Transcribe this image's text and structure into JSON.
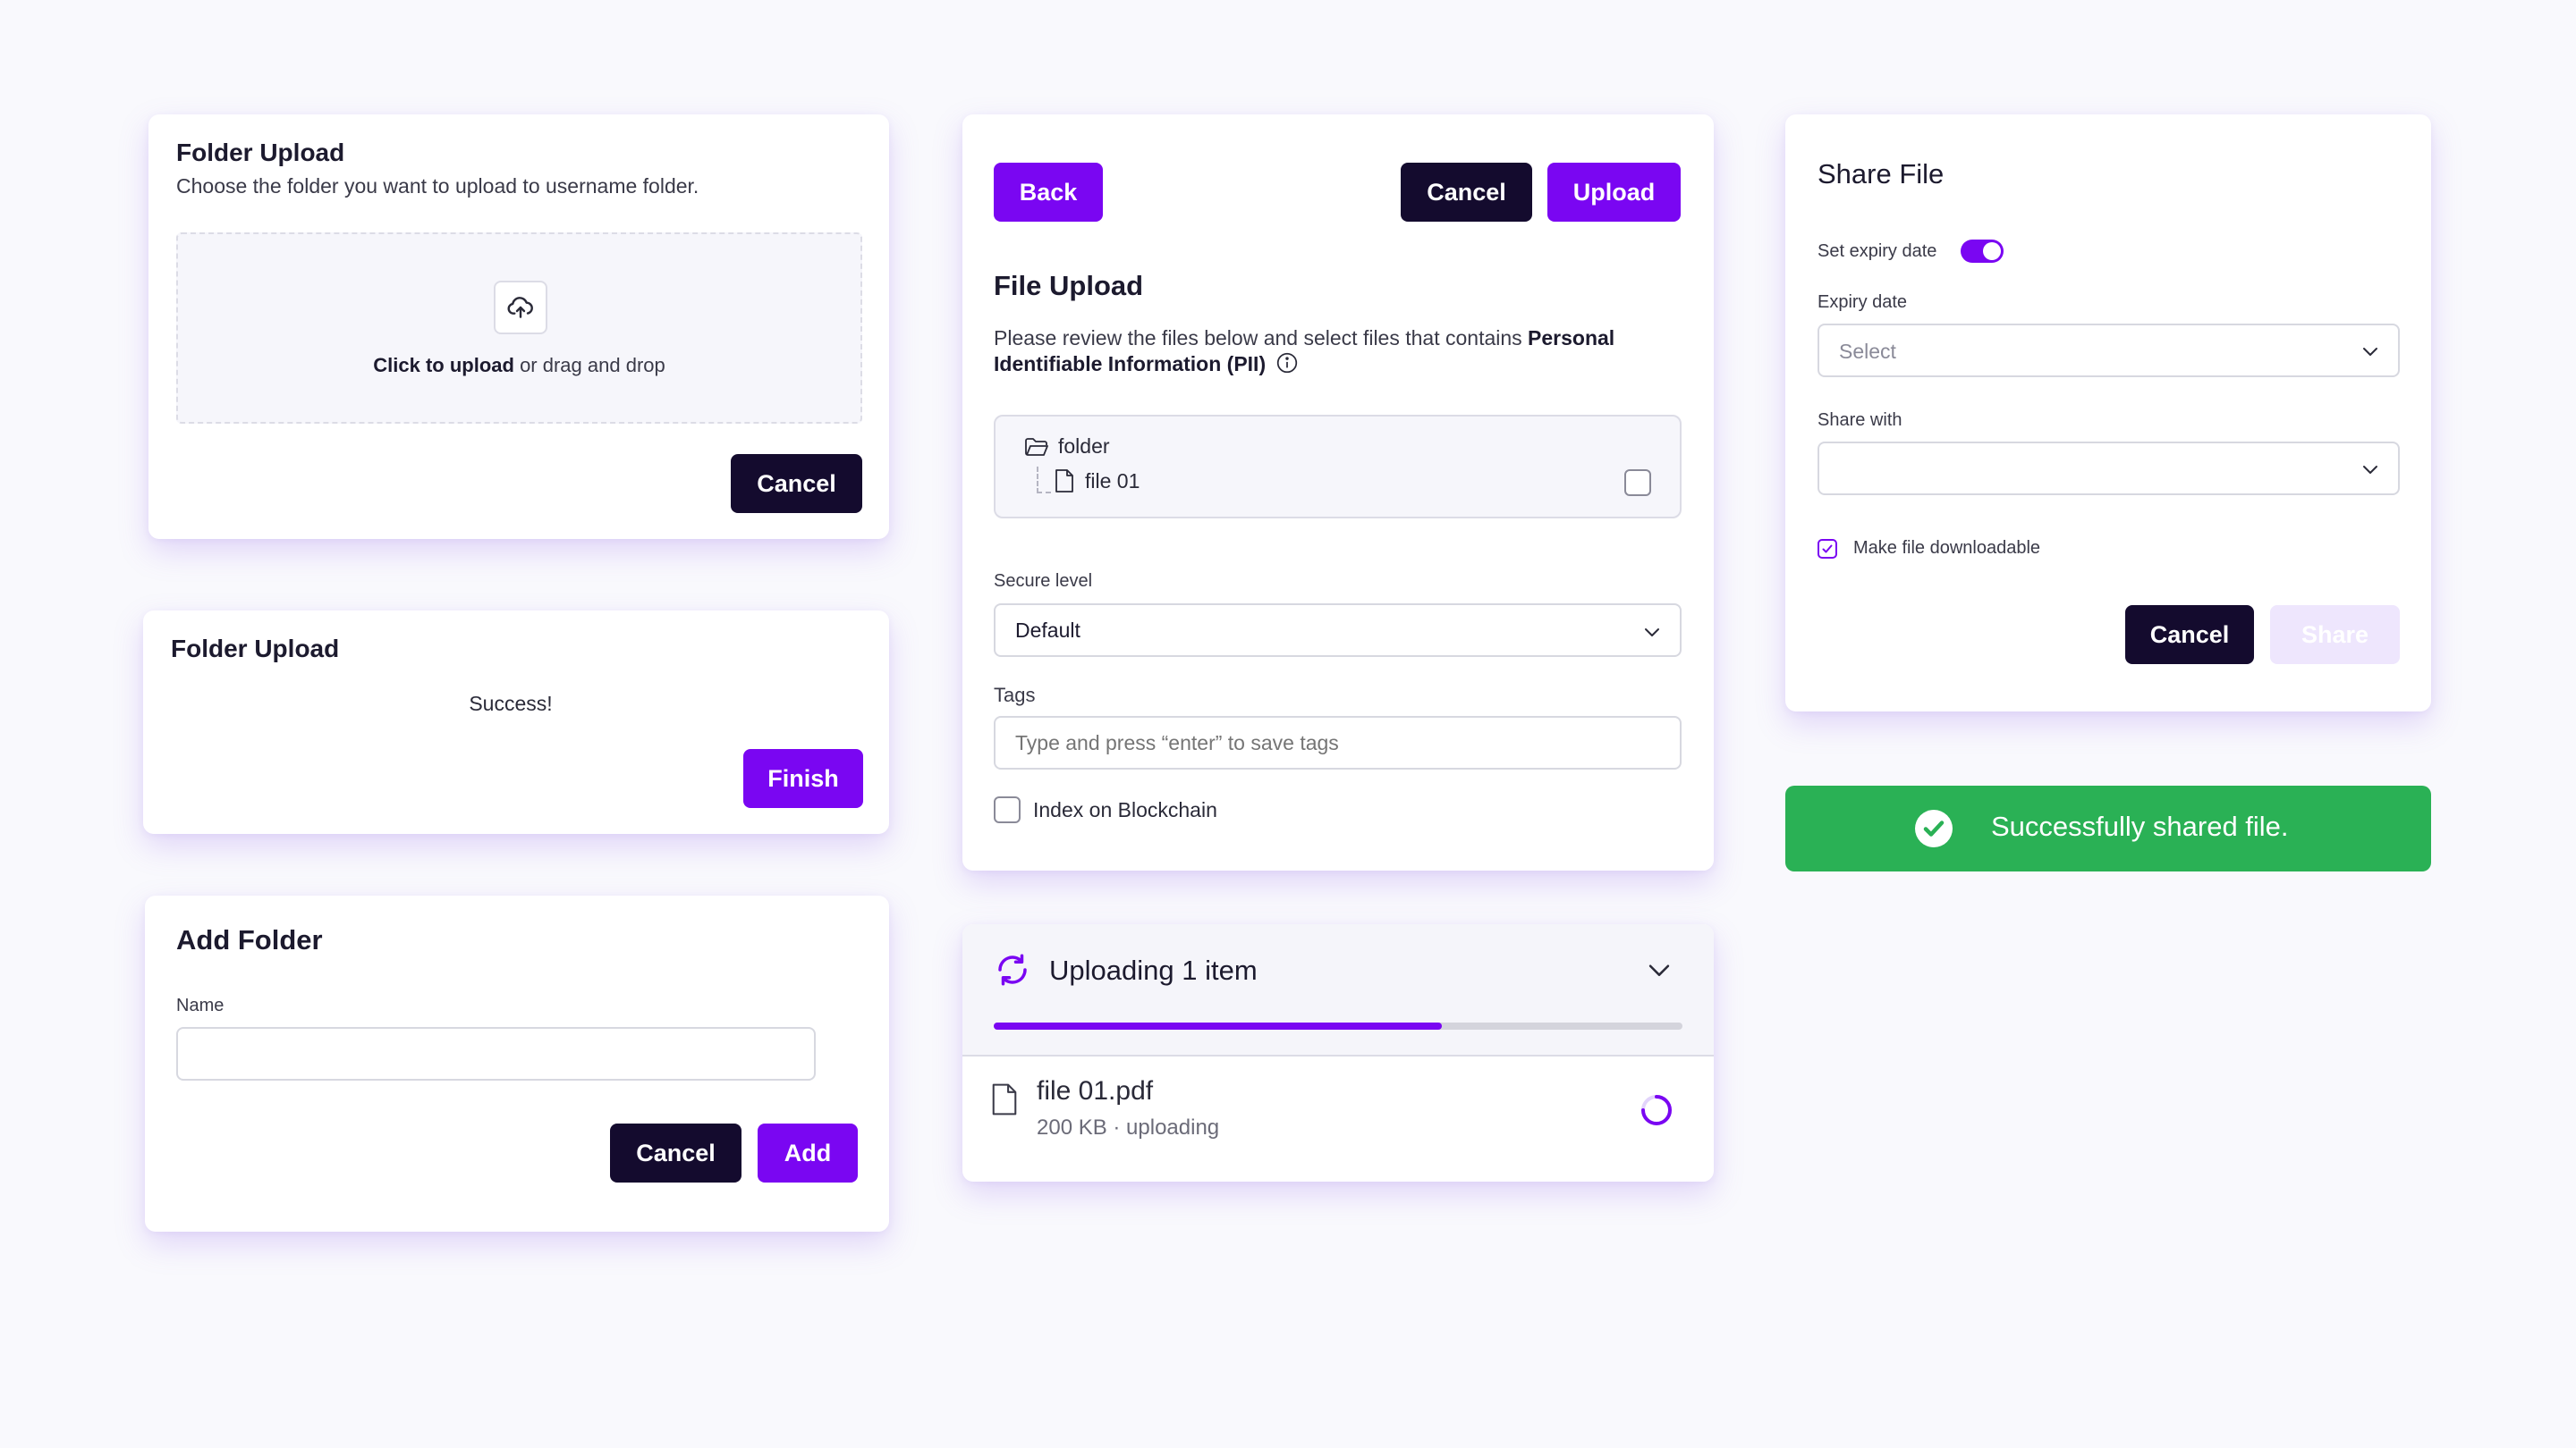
{
  "folder_upload_card": {
    "title": "Folder Upload",
    "subtitle": "Choose the folder you want to upload to username folder.",
    "dropzone_bold": "Click to upload",
    "dropzone_rest": " or drag and drop",
    "cancel_label": "Cancel"
  },
  "folder_upload_success_card": {
    "title": "Folder Upload",
    "message": "Success!",
    "finish_label": "Finish"
  },
  "add_folder_card": {
    "title": "Add Folder",
    "name_label": "Name",
    "name_value": "",
    "cancel_label": "Cancel",
    "add_label": "Add"
  },
  "file_upload_card": {
    "back_label": "Back",
    "cancel_label": "Cancel",
    "upload_label": "Upload",
    "title": "File Upload",
    "description": "Please review the files below and select files that contains ",
    "description_bold": "Personal Identifiable Information (PII)",
    "tree": {
      "folder_name": "folder",
      "file_name": "file 01",
      "file_checked": false
    },
    "secure_level_label": "Secure level",
    "secure_level_value": "Default",
    "tags_label": "Tags",
    "tags_placeholder": "Type and press “enter” to save tags",
    "index_label": "Index on Blockchain",
    "index_checked": false
  },
  "upload_progress_card": {
    "title": "Uploading 1 item",
    "progress_percent": 65,
    "file_name": "file 01.pdf",
    "file_meta": "200 KB · uploading"
  },
  "share_file_card": {
    "title": "Share File",
    "expiry_toggle_label": "Set expiry date",
    "expiry_toggle_on": true,
    "expiry_date_label": "Expiry date",
    "expiry_date_placeholder": "Select",
    "share_with_label": "Share with",
    "share_with_value": "",
    "downloadable_label": "Make file downloadable",
    "downloadable_checked": true,
    "cancel_label": "Cancel",
    "share_label": "Share"
  },
  "toast": {
    "message": "Successfully shared file.",
    "color": "#2ab155"
  },
  "colors": {
    "primary": "#7a06f2",
    "dark": "#140b2e",
    "background": "#f9f9fd"
  }
}
